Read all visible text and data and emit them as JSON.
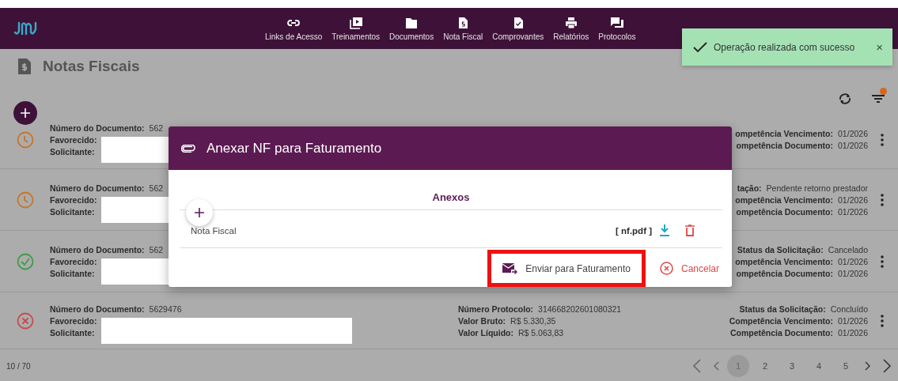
{
  "header": {
    "nav": [
      {
        "label": "Links de Acesso",
        "kind": "link"
      },
      {
        "label": "Treinamentos",
        "kind": "video"
      },
      {
        "label": "Documentos",
        "kind": "folder"
      },
      {
        "label": "Nota Fiscal",
        "kind": "invoice"
      },
      {
        "label": "Comprovantes",
        "kind": "receipt"
      },
      {
        "label": "Relatórios",
        "kind": "printer"
      },
      {
        "label": "Protocolos",
        "kind": "chat"
      }
    ]
  },
  "page": {
    "title": "Notas Fiscais"
  },
  "rows": [
    {
      "kind": "pending",
      "redacted": true,
      "left": [
        {
          "label": "Número do Documento:",
          "value": "562"
        },
        {
          "label": "Favorecido:"
        },
        {
          "label": "Solicitante:"
        }
      ],
      "middle": [],
      "right": [
        {
          "label": "ompetência Vencimento:",
          "value": "01/2026"
        },
        {
          "label": "ompetência Documento:",
          "value": "01/2026"
        }
      ]
    },
    {
      "kind": "pending",
      "redacted": true,
      "left": [
        {
          "label": "Número do Documento:",
          "value": "562"
        },
        {
          "label": "Favorecido:"
        },
        {
          "label": "Solicitante:"
        }
      ],
      "middle": [],
      "right": [
        {
          "label": "tação:",
          "value": "Pendente retorno prestador"
        },
        {
          "label": "ompetência Vencimento:",
          "value": "01/2026"
        },
        {
          "label": "ompetência Documento:",
          "value": "01/2026"
        }
      ]
    },
    {
      "kind": "approved",
      "redacted": true,
      "left": [
        {
          "label": "Número do Documento:",
          "value": "562"
        },
        {
          "label": "Favorecido:"
        },
        {
          "label": "Solicitante:"
        }
      ],
      "middle": [],
      "right": [
        {
          "label": "Status da Solicitação:",
          "value": "Cancelado"
        },
        {
          "label": "ompetência Vencimento:",
          "value": "01/2026"
        },
        {
          "label": "ompetência Documento:",
          "value": "01/2026"
        }
      ]
    },
    {
      "kind": "cancelled",
      "redacted": true,
      "left": [
        {
          "label": "Número do Documento:",
          "value": "5629476"
        },
        {
          "label": "Favorecido:"
        },
        {
          "label": "Solicitante:"
        }
      ],
      "middle": [
        {
          "label": "Número Protocolo:",
          "value": "314668202601080321"
        },
        {
          "label": "Valor Bruto:",
          "value": "R$ 5.330,35"
        },
        {
          "label": "Valor Líquido:",
          "value": "R$ 5.063,83"
        }
      ],
      "right": [
        {
          "label": "Status da Solicitação:",
          "value": "Concluído"
        },
        {
          "label": "Competência Vencimento:",
          "value": "01/2026"
        },
        {
          "label": "Competência Documento:",
          "value": "01/2026"
        }
      ]
    }
  ],
  "footer": {
    "count": "10 / 70",
    "pages": [
      {
        "label": "1",
        "selected": true
      },
      {
        "label": "2",
        "selected": false
      },
      {
        "label": "3",
        "selected": false
      },
      {
        "label": "4",
        "selected": false
      },
      {
        "label": "5",
        "selected": false
      }
    ]
  },
  "modal": {
    "title": "Anexar NF para Faturamento",
    "section": "Anexos",
    "attachment": {
      "label": "Nota Fiscal",
      "file": "[ nf.pdf ]"
    },
    "send": "Enviar para Faturamento",
    "cancel": "Cancelar"
  },
  "toast": {
    "message": "Operação realizada com sucesso",
    "close": "×"
  }
}
